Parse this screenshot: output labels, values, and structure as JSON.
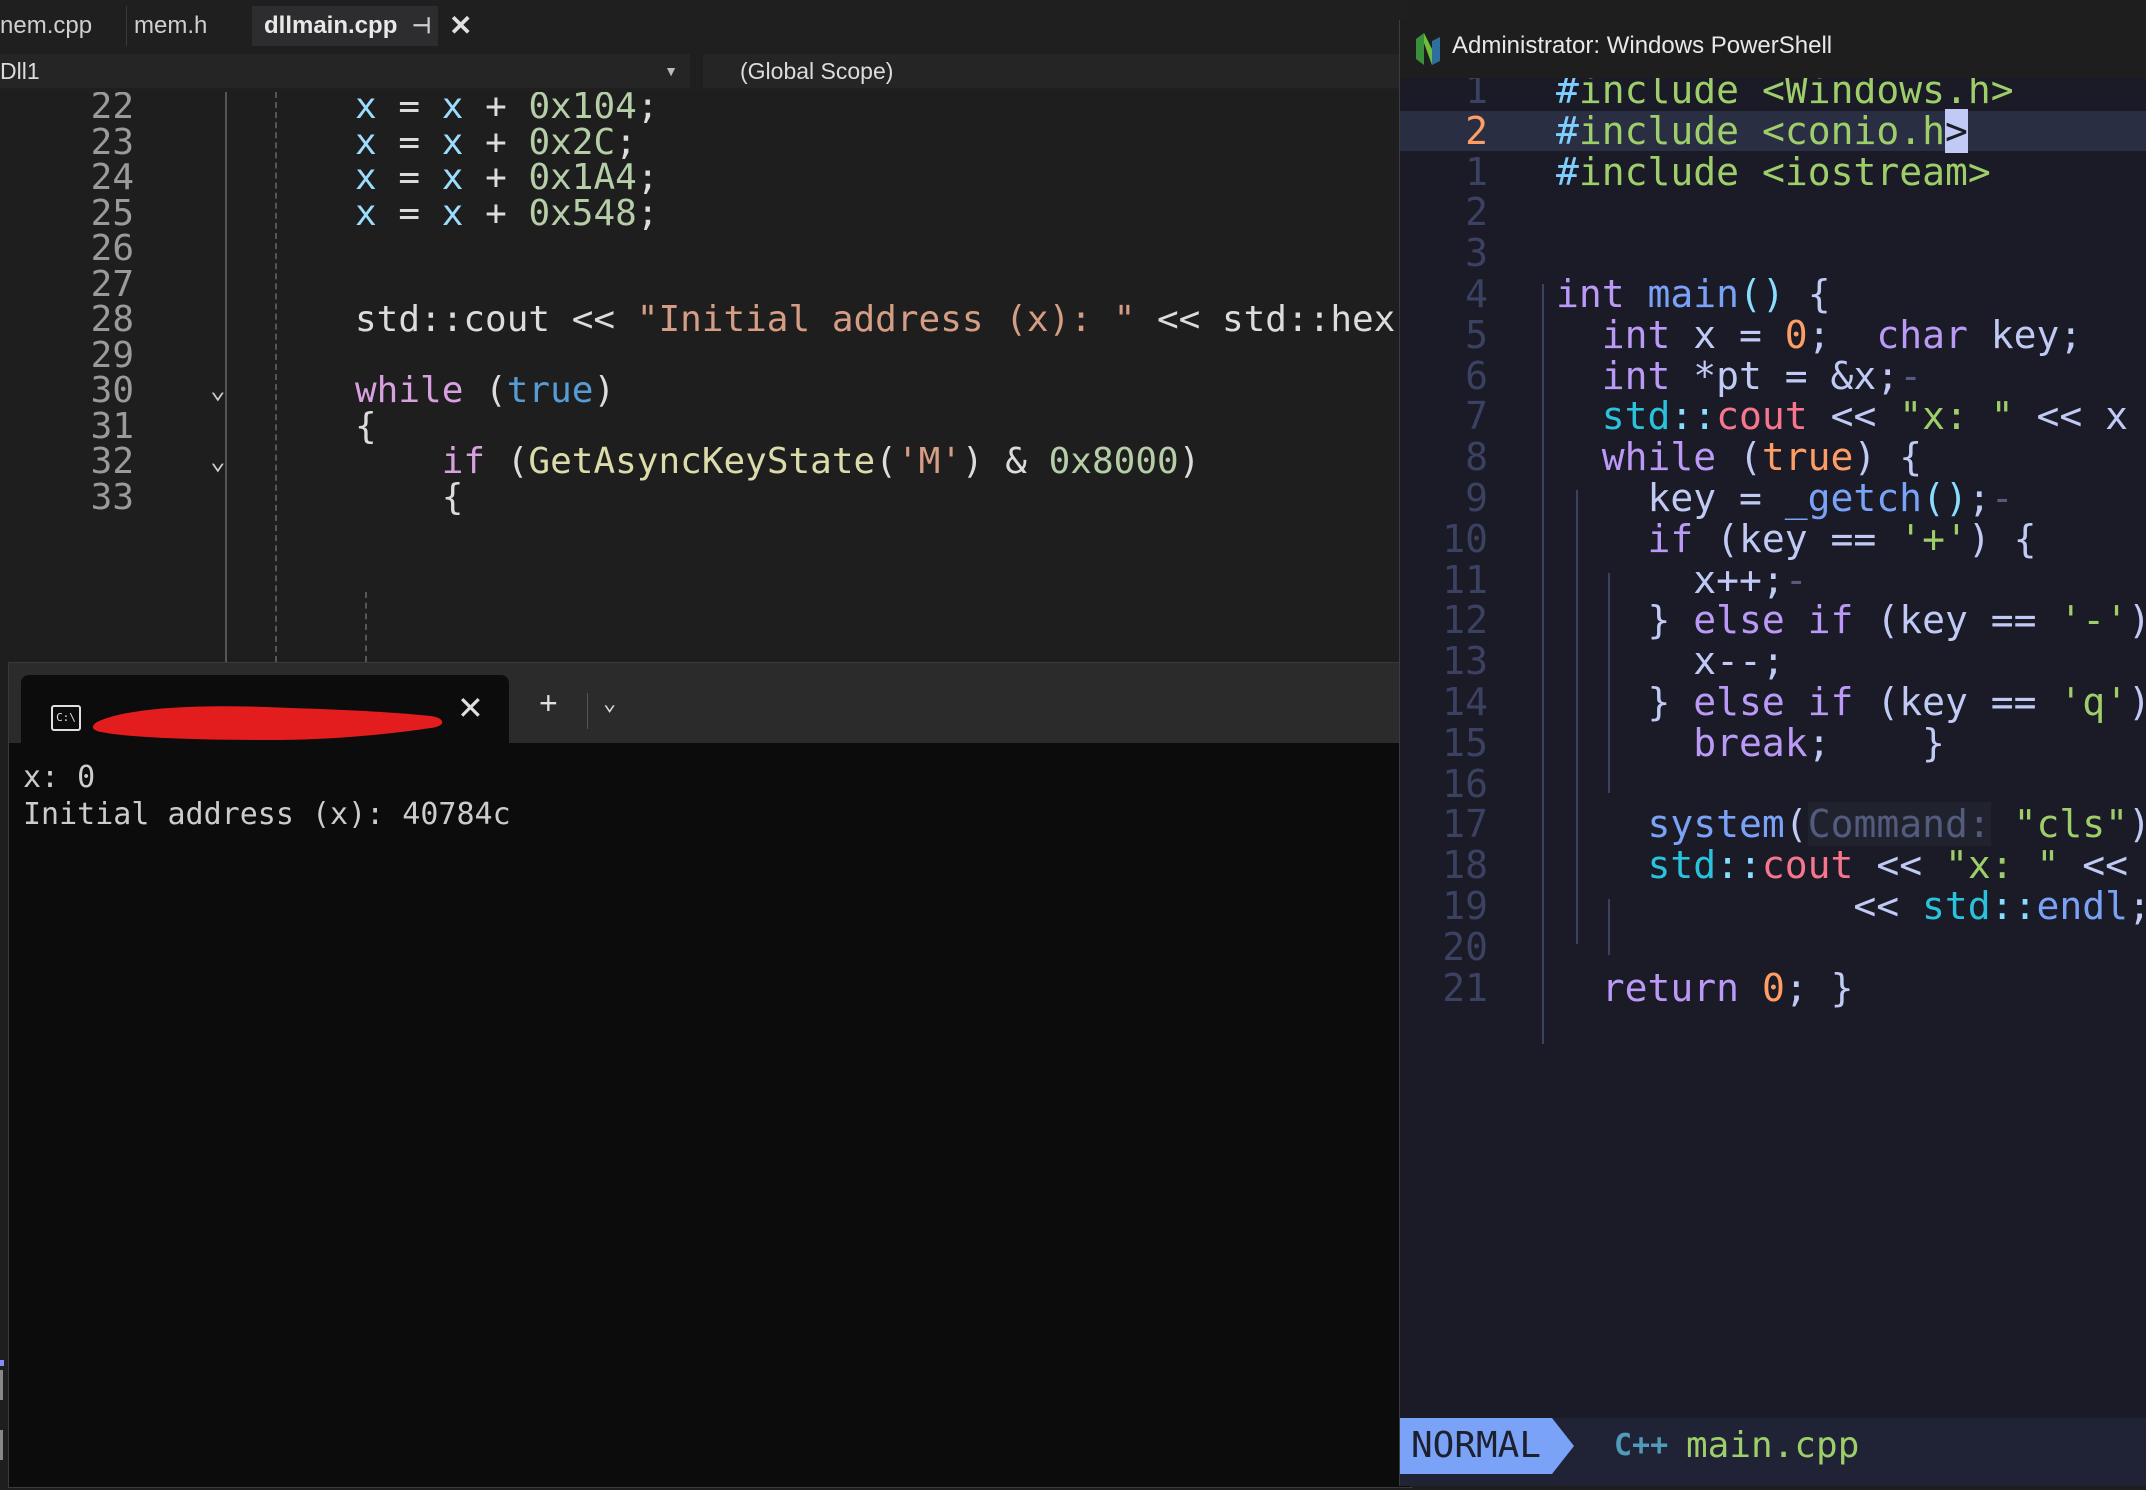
{
  "vs": {
    "tabs": [
      "nem.cpp",
      "mem.h",
      "dllmain.cpp"
    ],
    "active_tab_pin": "⊣",
    "active_tab_close": "✕",
    "nav_project": "Dll1",
    "nav_scope": "(Global Scope)",
    "lines": [
      {
        "num": "22",
        "code": [
          [
            "v",
            "x"
          ],
          [
            "p",
            " = "
          ],
          [
            "v",
            "x"
          ],
          [
            "p",
            " + "
          ],
          [
            "n",
            "0x104"
          ],
          [
            "p",
            ";"
          ]
        ]
      },
      {
        "num": "23",
        "code": [
          [
            "v",
            "x"
          ],
          [
            "p",
            " = "
          ],
          [
            "v",
            "x"
          ],
          [
            "p",
            " + "
          ],
          [
            "n",
            "0x2C"
          ],
          [
            "p",
            ";"
          ]
        ]
      },
      {
        "num": "24",
        "code": [
          [
            "v",
            "x"
          ],
          [
            "p",
            " = "
          ],
          [
            "v",
            "x"
          ],
          [
            "p",
            " + "
          ],
          [
            "n",
            "0x1A4"
          ],
          [
            "p",
            ";"
          ]
        ]
      },
      {
        "num": "25",
        "code": [
          [
            "v",
            "x"
          ],
          [
            "p",
            " = "
          ],
          [
            "v",
            "x"
          ],
          [
            "p",
            " + "
          ],
          [
            "n",
            "0x548"
          ],
          [
            "p",
            ";"
          ]
        ]
      },
      {
        "num": "26",
        "code": []
      },
      {
        "num": "27",
        "code": []
      },
      {
        "num": "28",
        "code": [
          [
            "p",
            "std::cout << "
          ],
          [
            "s",
            "\"Initial address (x): \""
          ],
          [
            "p",
            " << std::hex"
          ]
        ]
      },
      {
        "num": "29",
        "code": []
      },
      {
        "num": "30",
        "fold": true,
        "code": [
          [
            "ctl",
            "while"
          ],
          [
            "p",
            " ("
          ],
          [
            "k",
            "true"
          ],
          [
            "p",
            ")"
          ]
        ]
      },
      {
        "num": "31",
        "code": [
          [
            "p",
            "{"
          ]
        ]
      },
      {
        "num": "32",
        "fold": true,
        "code": [
          [
            "p",
            "    "
          ],
          [
            "ctl",
            "if"
          ],
          [
            "p",
            " ("
          ],
          [
            "f",
            "GetAsyncKeyState"
          ],
          [
            "p",
            "("
          ],
          [
            "s",
            "'M'"
          ],
          [
            "p",
            ") & "
          ],
          [
            "n",
            "0x8000"
          ],
          [
            "p",
            ")"
          ]
        ]
      },
      {
        "num": "33",
        "code": [
          [
            "p",
            "    {"
          ]
        ]
      }
    ]
  },
  "terminal": {
    "tab_close": "✕",
    "new_tab": "+",
    "dropdown": "⌄",
    "output": [
      "x: 0",
      "Initial address (x): 40784c"
    ]
  },
  "powershell": {
    "title": "Administrator: Windows PowerShell",
    "lines": [
      {
        "num": "1",
        "code": [
          [
            "g1",
            "#"
          ],
          [
            "gs",
            "include"
          ],
          [
            "gv",
            " "
          ],
          [
            "gs",
            "<Windows.h>"
          ]
        ]
      },
      {
        "num": "2",
        "current": true,
        "code": [
          [
            "g1",
            "#"
          ],
          [
            "gs",
            "include"
          ],
          [
            "gv",
            " "
          ],
          [
            "gs",
            "<conio.h"
          ],
          [
            "gcur",
            ">"
          ]
        ]
      },
      {
        "num": "1",
        "code": [
          [
            "g1",
            "#"
          ],
          [
            "gs",
            "include"
          ],
          [
            "gv",
            " "
          ],
          [
            "gs",
            "<iostream>"
          ]
        ]
      },
      {
        "num": "2",
        "code": []
      },
      {
        "num": "3",
        "code": []
      },
      {
        "num": "4",
        "code": [
          [
            "gk",
            "int"
          ],
          [
            "gv",
            " "
          ],
          [
            "gf",
            "main"
          ],
          [
            "gp",
            "()"
          ],
          [
            "gv",
            " {"
          ]
        ]
      },
      {
        "num": "5",
        "code": [
          [
            "gv",
            "  "
          ],
          [
            "gk",
            "int"
          ],
          [
            "gv",
            " x = "
          ],
          [
            "gn",
            "0"
          ],
          [
            "gv",
            ";  "
          ],
          [
            "gk",
            "char"
          ],
          [
            "gv",
            " key;"
          ]
        ]
      },
      {
        "num": "6",
        "code": [
          [
            "gv",
            "  "
          ],
          [
            "gk",
            "int"
          ],
          [
            "gv",
            " *pt = &x;"
          ],
          [
            "gc",
            "-"
          ]
        ]
      },
      {
        "num": "7",
        "code": [
          [
            "gv",
            "  "
          ],
          [
            "gt",
            "std"
          ],
          [
            "gp",
            "::"
          ],
          [
            "gr",
            "cout"
          ],
          [
            "gv",
            " << "
          ],
          [
            "gs",
            "\"x: \""
          ],
          [
            "gv",
            " << x <"
          ]
        ]
      },
      {
        "num": "8",
        "code": [
          [
            "gv",
            "  "
          ],
          [
            "gk",
            "while"
          ],
          [
            "gv",
            " ("
          ],
          [
            "gn",
            "true"
          ],
          [
            "gv",
            ") {"
          ]
        ]
      },
      {
        "num": "9",
        "code": [
          [
            "gv",
            "    key = "
          ],
          [
            "gf",
            "_getch"
          ],
          [
            "gp",
            "()"
          ],
          [
            "gv",
            ";"
          ],
          [
            "gc",
            "-"
          ]
        ]
      },
      {
        "num": "10",
        "code": [
          [
            "gv",
            "    "
          ],
          [
            "gk",
            "if"
          ],
          [
            "gv",
            " (key == "
          ],
          [
            "gs",
            "'+'"
          ],
          [
            "gv",
            ") {"
          ]
        ]
      },
      {
        "num": "11",
        "code": [
          [
            "gv",
            "      x++;"
          ],
          [
            "gc",
            "-"
          ]
        ]
      },
      {
        "num": "12",
        "code": [
          [
            "gv",
            "    } "
          ],
          [
            "gk",
            "else if"
          ],
          [
            "gv",
            " (key == "
          ],
          [
            "gs",
            "'-'"
          ],
          [
            "gv",
            ")"
          ]
        ]
      },
      {
        "num": "13",
        "code": [
          [
            "gv",
            "      x--;"
          ]
        ]
      },
      {
        "num": "14",
        "code": [
          [
            "gv",
            "    } "
          ],
          [
            "gk",
            "else if"
          ],
          [
            "gv",
            " (key == "
          ],
          [
            "gs",
            "'q'"
          ],
          [
            "gv",
            ")"
          ]
        ]
      },
      {
        "num": "15",
        "code": [
          [
            "gv",
            "      "
          ],
          [
            "gk",
            "break"
          ],
          [
            "gv",
            ";    }"
          ]
        ]
      },
      {
        "num": "16",
        "code": []
      },
      {
        "num": "17",
        "code": [
          [
            "gv",
            "    "
          ],
          [
            "gf",
            "system"
          ],
          [
            "gv",
            "("
          ],
          [
            "ghint",
            "Command:"
          ],
          [
            "gv",
            " "
          ],
          [
            "gs",
            "\"cls\""
          ],
          [
            "gv",
            ");"
          ]
        ]
      },
      {
        "num": "18",
        "code": [
          [
            "gv",
            "    "
          ],
          [
            "gt",
            "std"
          ],
          [
            "gp",
            "::"
          ],
          [
            "gr",
            "cout"
          ],
          [
            "gv",
            " << "
          ],
          [
            "gs",
            "\"x: \""
          ],
          [
            "gv",
            " << x"
          ]
        ]
      },
      {
        "num": "19",
        "code": [
          [
            "gv",
            "             << "
          ],
          [
            "gt",
            "std"
          ],
          [
            "gp",
            "::"
          ],
          [
            "gf",
            "endl"
          ],
          [
            "gv",
            ";"
          ]
        ]
      },
      {
        "num": "20",
        "code": []
      },
      {
        "num": "21",
        "code": [
          [
            "gv",
            "  "
          ],
          [
            "gk",
            "return"
          ],
          [
            "gv",
            " "
          ],
          [
            "gn",
            "0"
          ],
          [
            "gv",
            "; }"
          ]
        ]
      }
    ],
    "status": {
      "mode": "NORMAL",
      "filetype_icon": "C++",
      "filename": "main.cpp"
    }
  }
}
